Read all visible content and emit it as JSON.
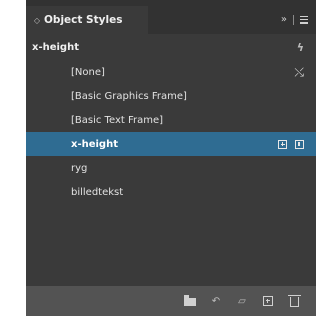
{
  "panel": {
    "tab_title": "Object Styles",
    "tab_collapse_glyph": "◇",
    "flyout_glyph": "»"
  },
  "list": {
    "header": "x-height",
    "items": [
      {
        "label": "[None]"
      },
      {
        "label": "[Basic Graphics Frame]"
      },
      {
        "label": "[Basic Text Frame]"
      },
      {
        "label": "x-height",
        "selected": true
      },
      {
        "label": "ryg"
      },
      {
        "label": "billedtekst"
      }
    ]
  },
  "icons": {
    "header_right": "lightning-icon",
    "none_right": "clear-override-wand-icon",
    "selected_right": [
      "default-graphic-frame-icon",
      "default-text-frame-icon"
    ]
  },
  "colors": {
    "panel_bg": "#3a3a3a",
    "selection": "#2f6c92"
  }
}
